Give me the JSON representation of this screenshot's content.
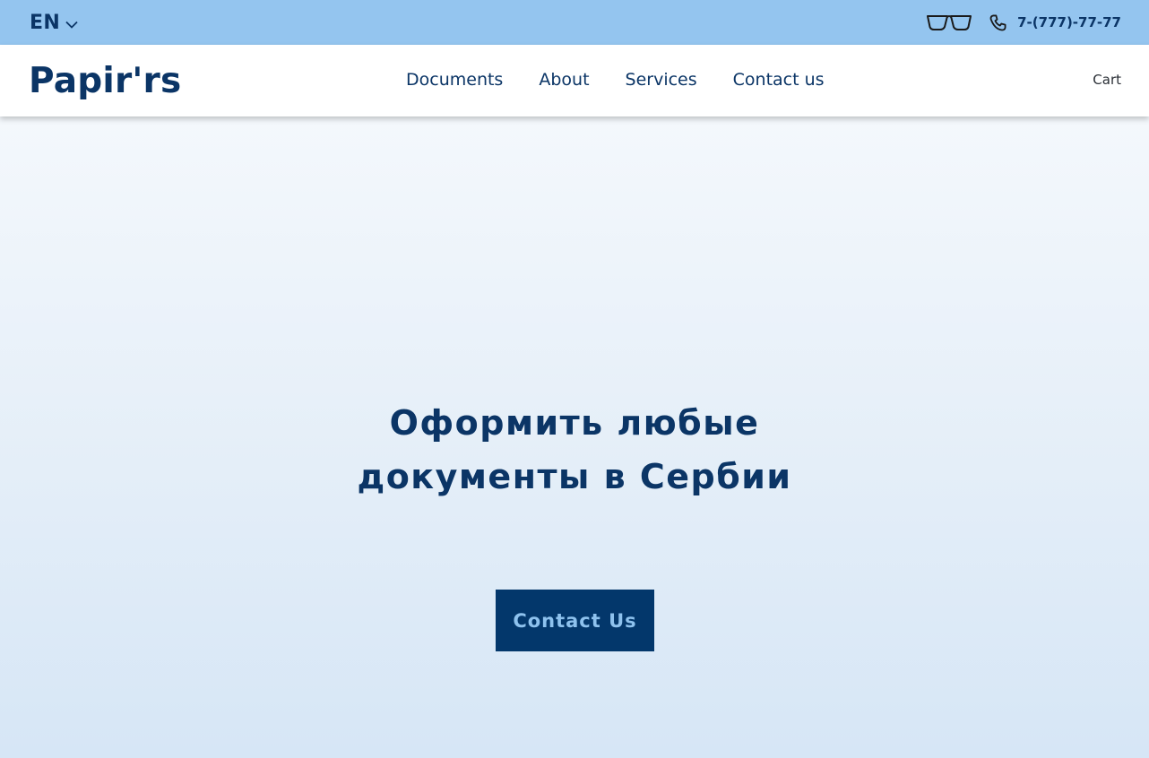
{
  "topbar": {
    "language": "EN",
    "phone": "7-(777)-77-77",
    "icons": [
      "chevron-down-icon",
      "glasses-icon",
      "phone-icon"
    ]
  },
  "header": {
    "logo": "Papir'rs",
    "nav": [
      {
        "label": "Documents"
      },
      {
        "label": "About"
      },
      {
        "label": "Services"
      },
      {
        "label": "Contact us"
      }
    ],
    "cart": "Cart"
  },
  "hero": {
    "title_line1": "Оформить любые",
    "title_line2": "документы в Сербии",
    "cta_label": "Contact Us"
  },
  "colors": {
    "topbar_bg": "#94c5ef",
    "brand_navy": "#0b3566",
    "cta_bg": "#03376b",
    "cta_text": "#8ec2ee"
  }
}
